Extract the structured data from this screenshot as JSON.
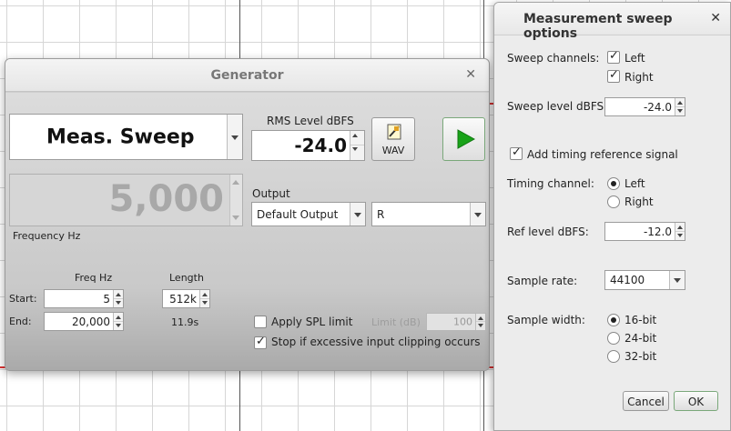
{
  "generator": {
    "title": "Generator",
    "signal_type": "Meas. Sweep",
    "rms_label": "RMS Level dBFS",
    "rms_value": "-24.0",
    "wav_label": "WAV",
    "frequency_value": "5,000",
    "frequency_label": "Frequency Hz",
    "output_label": "Output",
    "output_device": "Default Output",
    "output_channel": "R",
    "freq_header": "Freq Hz",
    "length_header": "Length",
    "start_label": "Start:",
    "end_label": "End:",
    "start_value": "5",
    "end_value": "20,000",
    "length_value": "512k",
    "length_time": "11.9s",
    "apply_spl_label": "Apply SPL limit",
    "limit_label": "Limit (dB)",
    "limit_value": "100",
    "stop_clipping_label": "Stop if excessive input clipping occurs",
    "apply_spl_checked": false,
    "stop_clipping_checked": true
  },
  "dialog": {
    "title": "Measurement sweep options",
    "sweep_channels_label": "Sweep channels:",
    "left_label": "Left",
    "right_label": "Right",
    "left_checked": true,
    "right_checked": true,
    "sweep_level_label": "Sweep level dBFS:",
    "sweep_level_value": "-24.0",
    "timing_ref_label": "Add timing reference signal",
    "timing_ref_checked": true,
    "timing_channel_label": "Timing channel:",
    "timing_left_label": "Left",
    "timing_right_label": "Right",
    "timing_selected": "Left",
    "ref_level_label": "Ref level dBFS:",
    "ref_level_value": "-12.0",
    "sample_rate_label": "Sample rate:",
    "sample_rate_value": "44100",
    "sample_width_label": "Sample width:",
    "width_16": "16-bit",
    "width_24": "24-bit",
    "width_32": "32-bit",
    "width_selected": "16-bit",
    "cancel_label": "Cancel",
    "ok_label": "OK"
  },
  "colors": {
    "play_green": "#19a319",
    "graph_red": "#dd3333",
    "accent_green_border": "#7aa87a"
  },
  "icons": {
    "close": "close-icon",
    "play": "play-icon",
    "wav": "wav-file-icon"
  }
}
